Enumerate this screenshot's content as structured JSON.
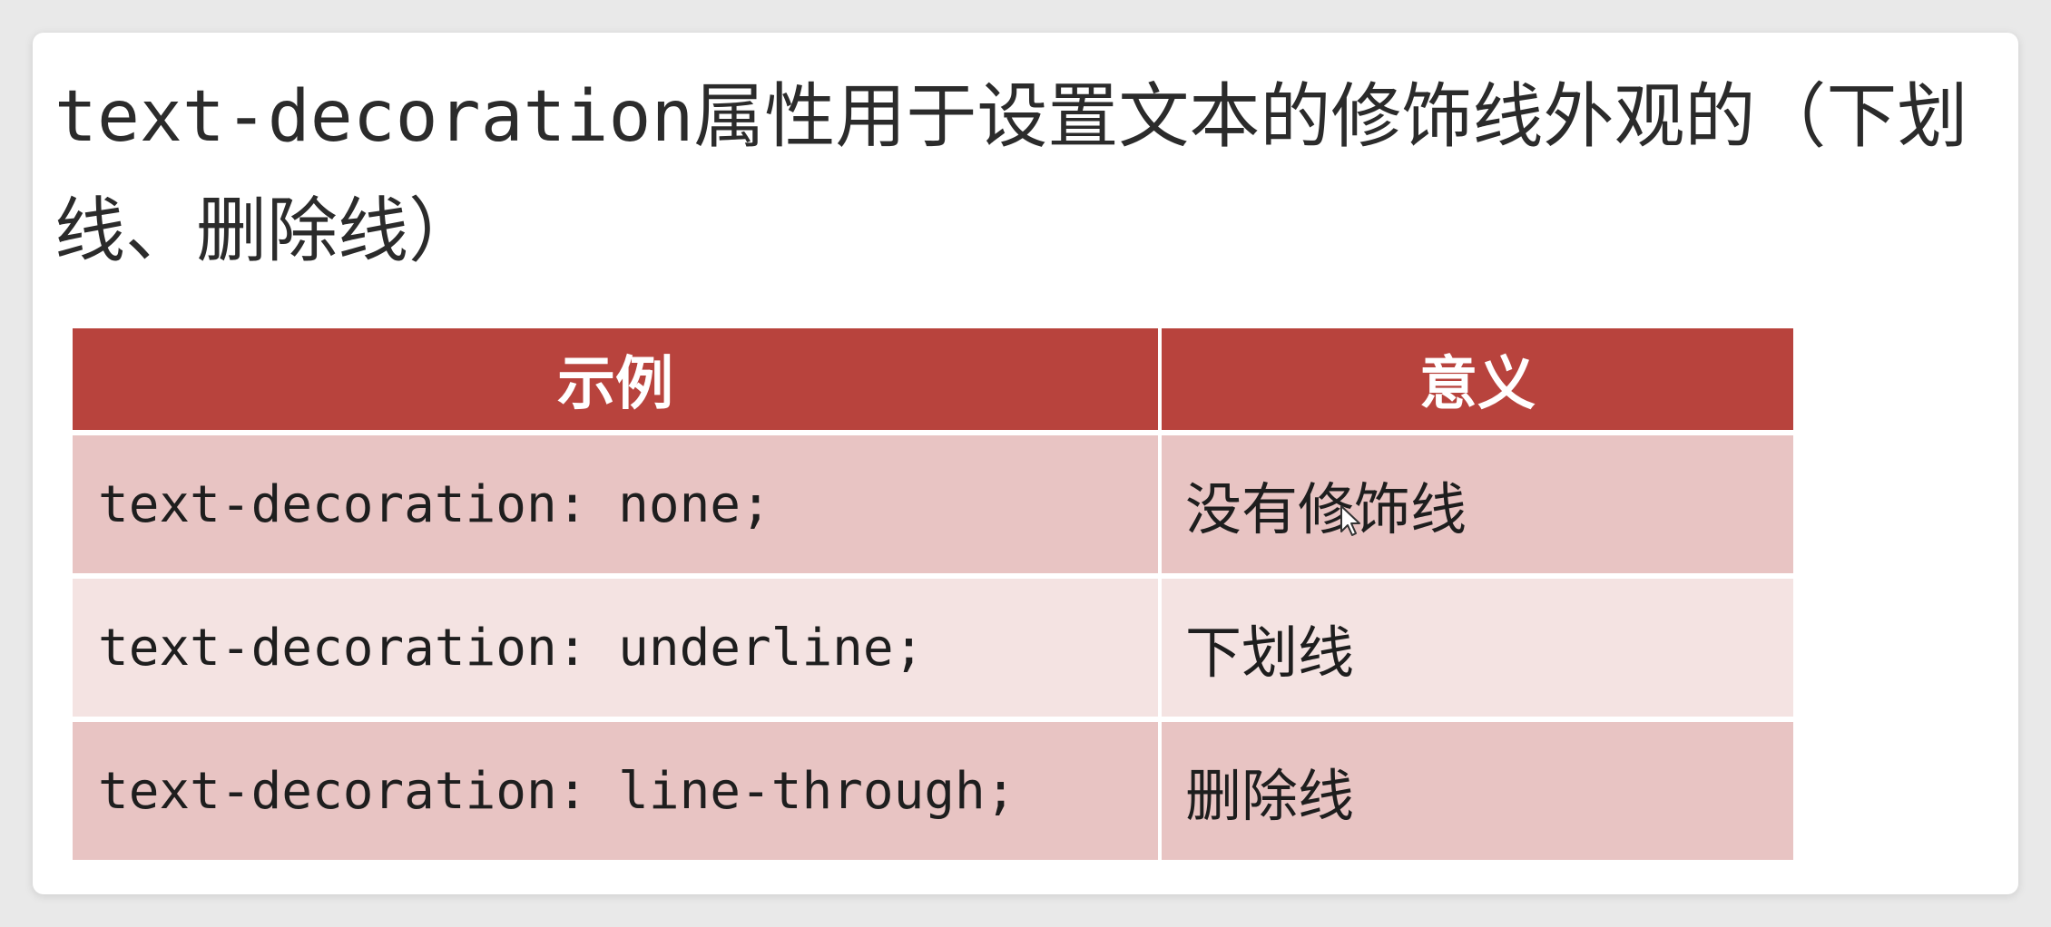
{
  "intro": {
    "code_part": "text-decoration",
    "text_part": "属性用于设置文本的修饰线外观的（下划线、删除线）"
  },
  "table": {
    "headers": [
      "示例",
      "意义"
    ],
    "rows": [
      {
        "example": "text-decoration: none;",
        "meaning": "没有修饰线"
      },
      {
        "example": "text-decoration: underline;",
        "meaning": "下划线"
      },
      {
        "example": "text-decoration: line-through;",
        "meaning": "删除线"
      }
    ]
  },
  "colors": {
    "header_bg": "#b8433d",
    "row_dark": "#e8c4c3",
    "row_light": "#f4e3e2"
  },
  "icons": {
    "cursor": "mouse-pointer-icon"
  }
}
